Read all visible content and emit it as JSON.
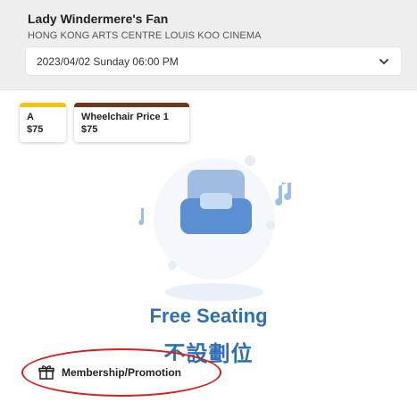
{
  "event": {
    "title": "Lady Windermere's Fan",
    "venue": "HONG KONG ARTS CENTRE LOUIS KOO CINEMA"
  },
  "performance_select": {
    "value": "2023/04/02 Sunday 06:00 PM",
    "icon": "chevron-down-icon"
  },
  "price_zones": [
    {
      "name": "A",
      "price": "$75",
      "color": "#f1c40f"
    },
    {
      "name": "Wheelchair Price 1",
      "price": "$75",
      "color": "#6b3a1e"
    }
  ],
  "seating": {
    "title_en": "Free Seating",
    "title_zh": "不設劃位",
    "accent_color": "#2f6eb4"
  },
  "promotion": {
    "label": "Membership/Promotion",
    "icon": "gift-icon"
  },
  "annotation_color": "#d81e1e"
}
